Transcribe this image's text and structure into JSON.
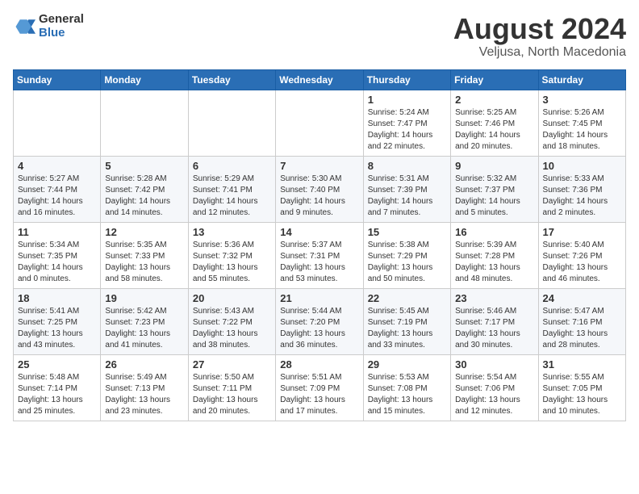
{
  "header": {
    "logo_general": "General",
    "logo_blue": "Blue",
    "month_year": "August 2024",
    "location": "Veljusa, North Macedonia"
  },
  "weekdays": [
    "Sunday",
    "Monday",
    "Tuesday",
    "Wednesday",
    "Thursday",
    "Friday",
    "Saturday"
  ],
  "weeks": [
    [
      {
        "day": "",
        "info": ""
      },
      {
        "day": "",
        "info": ""
      },
      {
        "day": "",
        "info": ""
      },
      {
        "day": "",
        "info": ""
      },
      {
        "day": "1",
        "info": "Sunrise: 5:24 AM\nSunset: 7:47 PM\nDaylight: 14 hours\nand 22 minutes."
      },
      {
        "day": "2",
        "info": "Sunrise: 5:25 AM\nSunset: 7:46 PM\nDaylight: 14 hours\nand 20 minutes."
      },
      {
        "day": "3",
        "info": "Sunrise: 5:26 AM\nSunset: 7:45 PM\nDaylight: 14 hours\nand 18 minutes."
      }
    ],
    [
      {
        "day": "4",
        "info": "Sunrise: 5:27 AM\nSunset: 7:44 PM\nDaylight: 14 hours\nand 16 minutes."
      },
      {
        "day": "5",
        "info": "Sunrise: 5:28 AM\nSunset: 7:42 PM\nDaylight: 14 hours\nand 14 minutes."
      },
      {
        "day": "6",
        "info": "Sunrise: 5:29 AM\nSunset: 7:41 PM\nDaylight: 14 hours\nand 12 minutes."
      },
      {
        "day": "7",
        "info": "Sunrise: 5:30 AM\nSunset: 7:40 PM\nDaylight: 14 hours\nand 9 minutes."
      },
      {
        "day": "8",
        "info": "Sunrise: 5:31 AM\nSunset: 7:39 PM\nDaylight: 14 hours\nand 7 minutes."
      },
      {
        "day": "9",
        "info": "Sunrise: 5:32 AM\nSunset: 7:37 PM\nDaylight: 14 hours\nand 5 minutes."
      },
      {
        "day": "10",
        "info": "Sunrise: 5:33 AM\nSunset: 7:36 PM\nDaylight: 14 hours\nand 2 minutes."
      }
    ],
    [
      {
        "day": "11",
        "info": "Sunrise: 5:34 AM\nSunset: 7:35 PM\nDaylight: 14 hours\nand 0 minutes."
      },
      {
        "day": "12",
        "info": "Sunrise: 5:35 AM\nSunset: 7:33 PM\nDaylight: 13 hours\nand 58 minutes."
      },
      {
        "day": "13",
        "info": "Sunrise: 5:36 AM\nSunset: 7:32 PM\nDaylight: 13 hours\nand 55 minutes."
      },
      {
        "day": "14",
        "info": "Sunrise: 5:37 AM\nSunset: 7:31 PM\nDaylight: 13 hours\nand 53 minutes."
      },
      {
        "day": "15",
        "info": "Sunrise: 5:38 AM\nSunset: 7:29 PM\nDaylight: 13 hours\nand 50 minutes."
      },
      {
        "day": "16",
        "info": "Sunrise: 5:39 AM\nSunset: 7:28 PM\nDaylight: 13 hours\nand 48 minutes."
      },
      {
        "day": "17",
        "info": "Sunrise: 5:40 AM\nSunset: 7:26 PM\nDaylight: 13 hours\nand 46 minutes."
      }
    ],
    [
      {
        "day": "18",
        "info": "Sunrise: 5:41 AM\nSunset: 7:25 PM\nDaylight: 13 hours\nand 43 minutes."
      },
      {
        "day": "19",
        "info": "Sunrise: 5:42 AM\nSunset: 7:23 PM\nDaylight: 13 hours\nand 41 minutes."
      },
      {
        "day": "20",
        "info": "Sunrise: 5:43 AM\nSunset: 7:22 PM\nDaylight: 13 hours\nand 38 minutes."
      },
      {
        "day": "21",
        "info": "Sunrise: 5:44 AM\nSunset: 7:20 PM\nDaylight: 13 hours\nand 36 minutes."
      },
      {
        "day": "22",
        "info": "Sunrise: 5:45 AM\nSunset: 7:19 PM\nDaylight: 13 hours\nand 33 minutes."
      },
      {
        "day": "23",
        "info": "Sunrise: 5:46 AM\nSunset: 7:17 PM\nDaylight: 13 hours\nand 30 minutes."
      },
      {
        "day": "24",
        "info": "Sunrise: 5:47 AM\nSunset: 7:16 PM\nDaylight: 13 hours\nand 28 minutes."
      }
    ],
    [
      {
        "day": "25",
        "info": "Sunrise: 5:48 AM\nSunset: 7:14 PM\nDaylight: 13 hours\nand 25 minutes."
      },
      {
        "day": "26",
        "info": "Sunrise: 5:49 AM\nSunset: 7:13 PM\nDaylight: 13 hours\nand 23 minutes."
      },
      {
        "day": "27",
        "info": "Sunrise: 5:50 AM\nSunset: 7:11 PM\nDaylight: 13 hours\nand 20 minutes."
      },
      {
        "day": "28",
        "info": "Sunrise: 5:51 AM\nSunset: 7:09 PM\nDaylight: 13 hours\nand 17 minutes."
      },
      {
        "day": "29",
        "info": "Sunrise: 5:53 AM\nSunset: 7:08 PM\nDaylight: 13 hours\nand 15 minutes."
      },
      {
        "day": "30",
        "info": "Sunrise: 5:54 AM\nSunset: 7:06 PM\nDaylight: 13 hours\nand 12 minutes."
      },
      {
        "day": "31",
        "info": "Sunrise: 5:55 AM\nSunset: 7:05 PM\nDaylight: 13 hours\nand 10 minutes."
      }
    ]
  ]
}
